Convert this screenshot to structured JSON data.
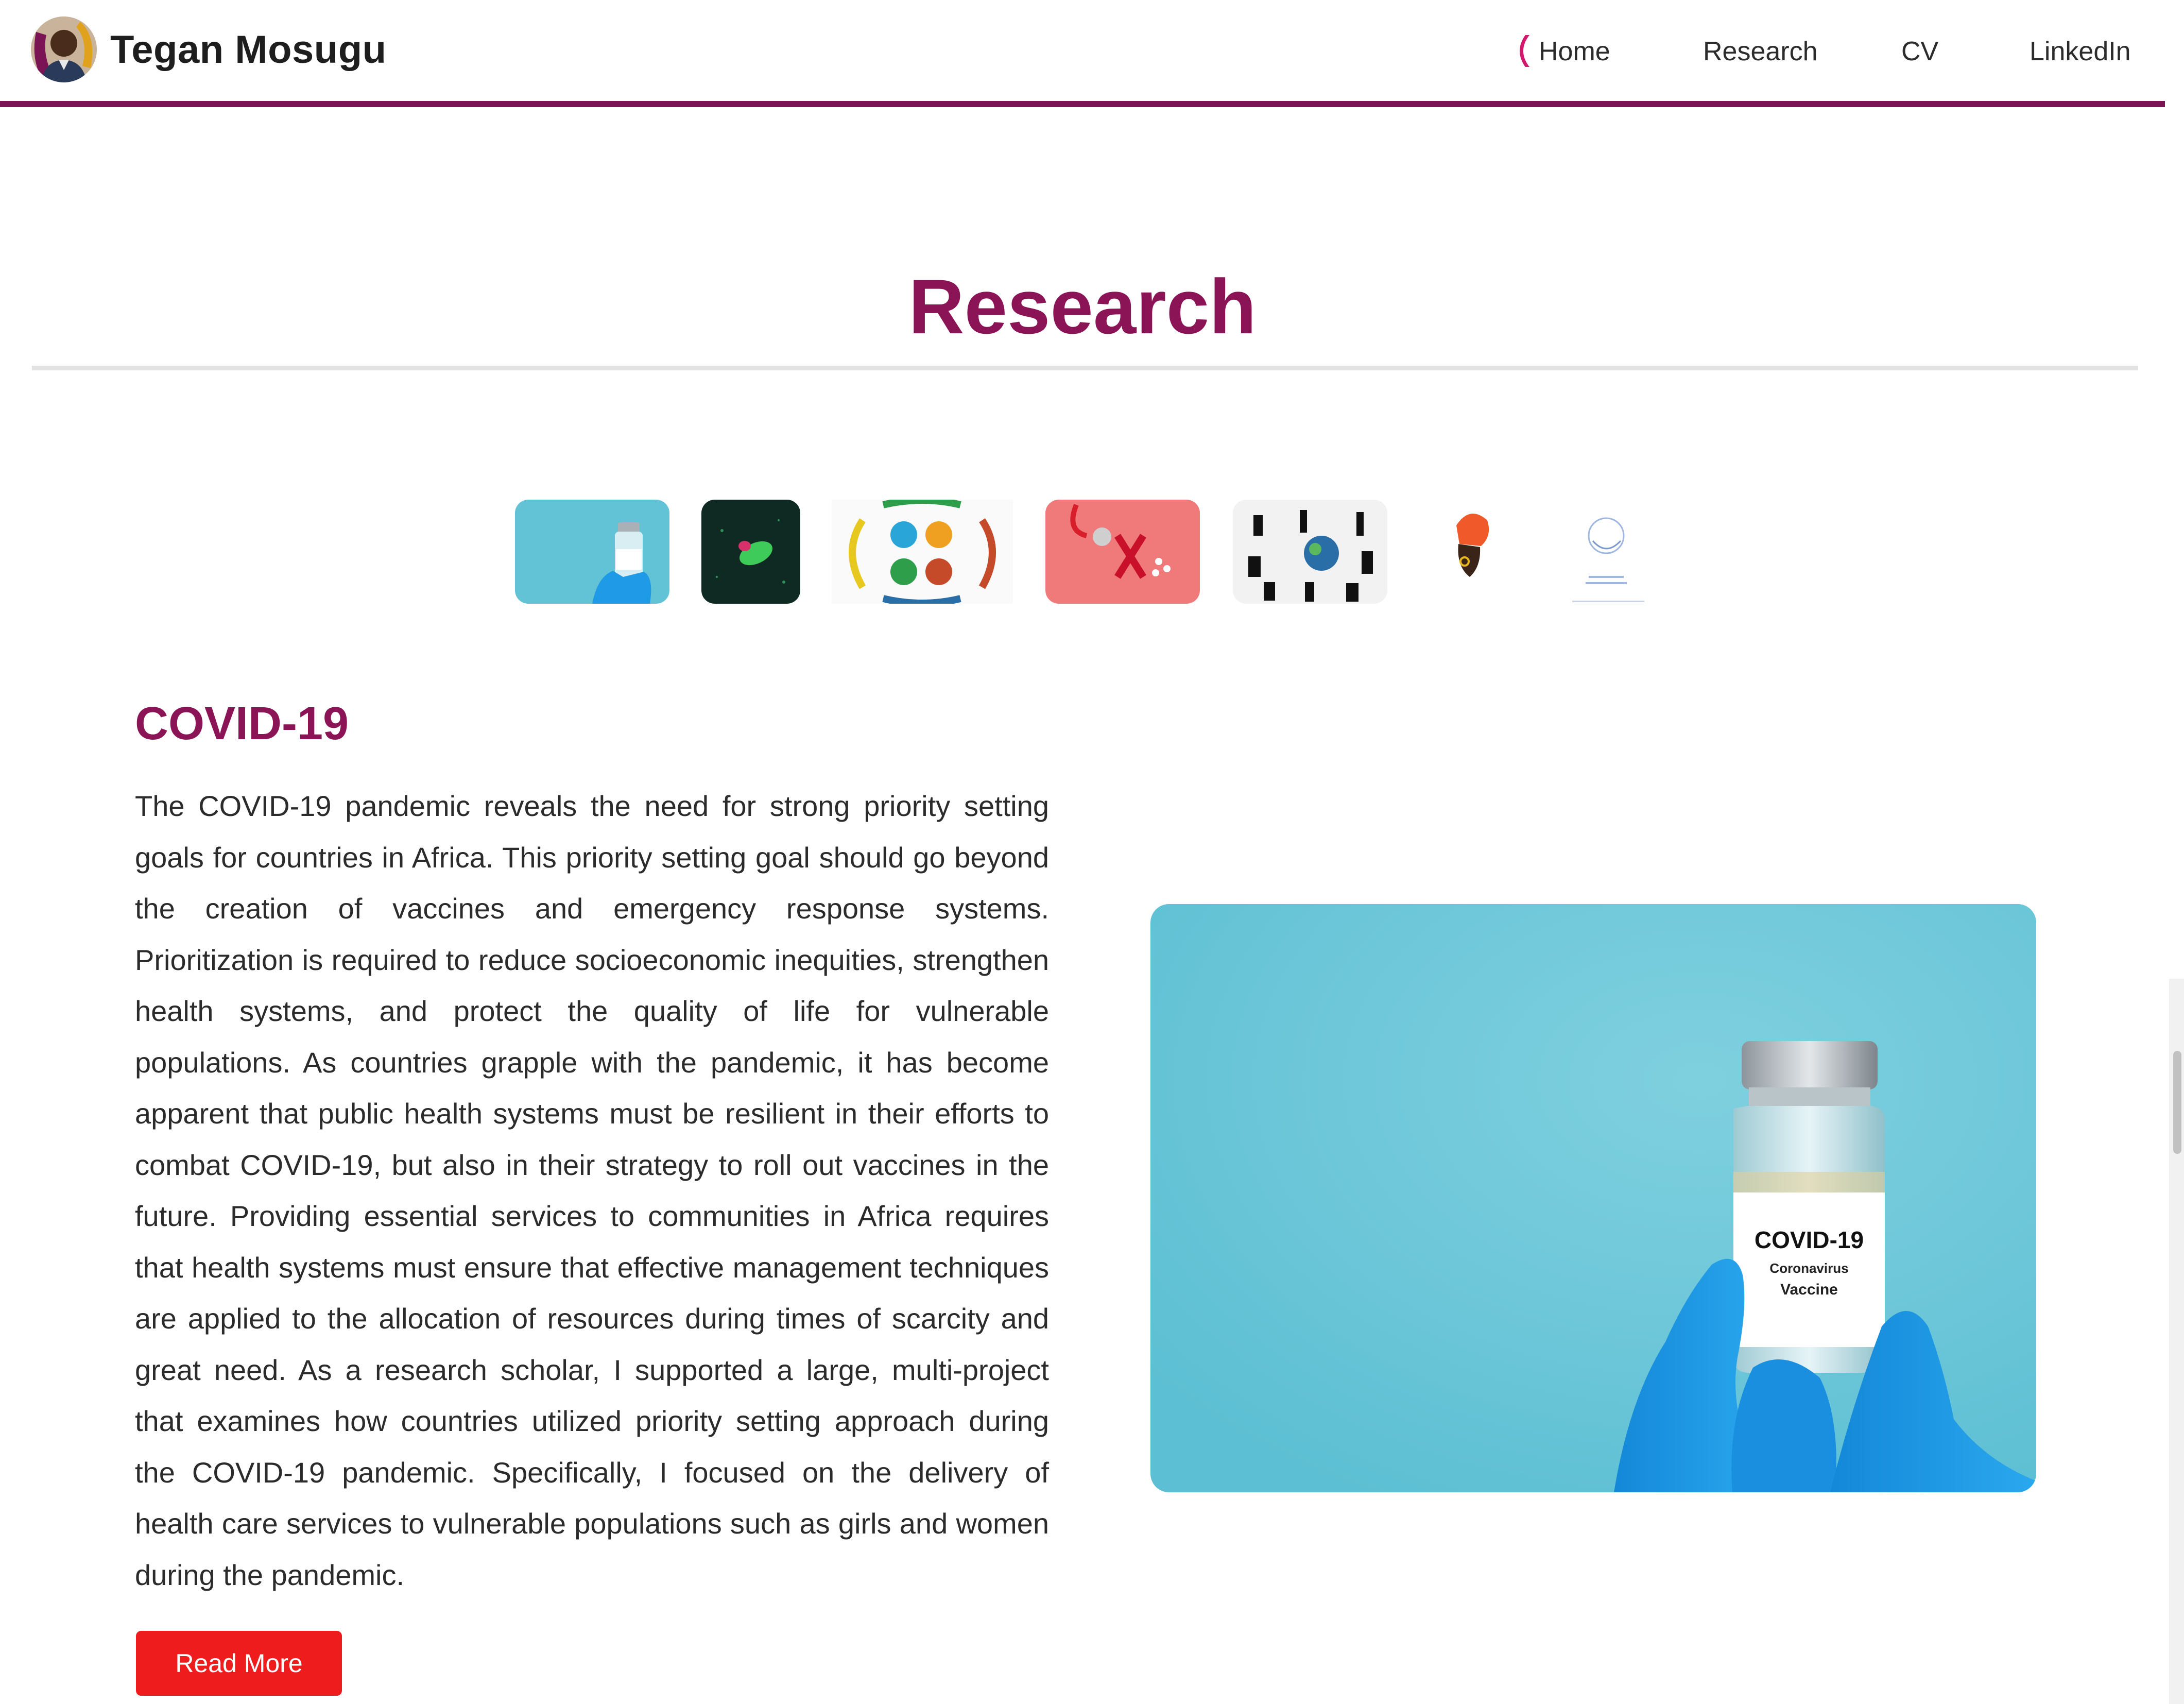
{
  "header": {
    "brand_name": "Tegan Mosugu",
    "nav": [
      {
        "label": "Home",
        "active": true
      },
      {
        "label": "Research",
        "active": false
      },
      {
        "label": "CV",
        "active": false
      },
      {
        "label": "LinkedIn",
        "active": false
      }
    ]
  },
  "page": {
    "title": "Research"
  },
  "thumbnails": [
    {
      "name": "covid-19-vaccine"
    },
    {
      "name": "green-pill"
    },
    {
      "name": "health-icons-circle"
    },
    {
      "name": "red-ribbon-stethoscope"
    },
    {
      "name": "people-silhouettes-globe"
    },
    {
      "name": "woman-head-wrap"
    },
    {
      "name": "hands-logo"
    }
  ],
  "section": {
    "heading": "COVID-19",
    "paragraph": "The COVID-19 pandemic reveals the need for strong priority setting goals for countries in Africa. This priority setting goal should go beyond the creation of vaccines and emergency response systems. Prioritization is required to reduce socioeconomic inequities, strengthen health systems, and protect the quality of life for vulnerable populations. As countries grapple with the pandemic, it has become apparent that public health systems must be resilient in their efforts to combat COVID-19, but also in their strategy to roll out vaccines in the future. Providing essential services to communities in Africa requires that health systems must ensure that effective management techniques are applied to the allocation of resources during times of scarcity and great need. As a research scholar, I supported a large, multi-project that examines how countries utilized priority setting approach during the COVID-19 pandemic. Specifically, I focused on the delivery of health care services to vulnerable populations such as girls and women during the pandemic.",
    "read_more_label": "Read More",
    "image": {
      "vial_label_title": "COVID-19",
      "vial_label_line1": "Coronavirus",
      "vial_label_line2": "Vaccine"
    }
  },
  "colors": {
    "accent": "#8b1456",
    "header_rule": "#7a1454",
    "button": "#ee1c1c",
    "image_background": "#62c3d6",
    "glove": "#1e9ae6"
  }
}
